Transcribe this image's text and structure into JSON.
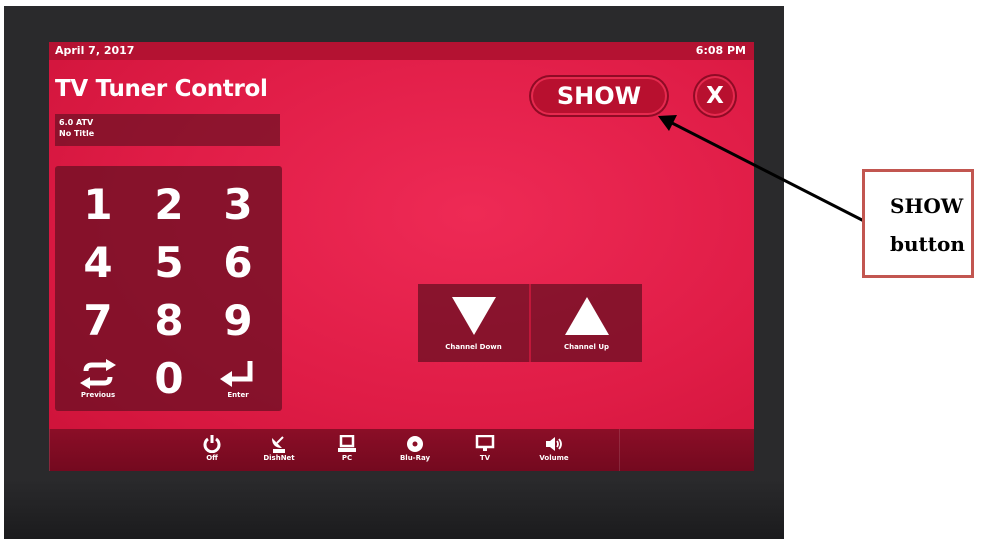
{
  "status": {
    "date": "April 7, 2017",
    "time": "6:08 PM"
  },
  "page": {
    "title": "TV Tuner Control"
  },
  "channel": {
    "number": "6.0 ATV",
    "title": "No Title"
  },
  "header": {
    "show_label": "SHOW",
    "close_label": "X"
  },
  "keypad": {
    "digits": [
      "1",
      "2",
      "3",
      "4",
      "5",
      "6",
      "7",
      "8",
      "9",
      "0"
    ],
    "previous_label": "Previous",
    "enter_label": "Enter",
    "previous_icon": "repeat-icon",
    "enter_icon": "enter-icon"
  },
  "channel_controls": {
    "down_label": "Channel Down",
    "up_label": "Channel Up"
  },
  "sources": [
    {
      "label": "Off",
      "icon": "power-icon"
    },
    {
      "label": "DishNet",
      "icon": "satellite-dish-icon"
    },
    {
      "label": "PC",
      "icon": "laptop-icon"
    },
    {
      "label": "Blu-Ray",
      "icon": "disc-icon"
    },
    {
      "label": "TV",
      "icon": "tv-icon"
    },
    {
      "label": "Volume",
      "icon": "speaker-icon"
    }
  ],
  "annotation": {
    "line1": "SHOW",
    "line2": "button"
  },
  "colors": {
    "screen": "#df1c46",
    "panel": "#6e1024",
    "bezel": "#2a2a2c",
    "callout_border": "#c25650"
  }
}
